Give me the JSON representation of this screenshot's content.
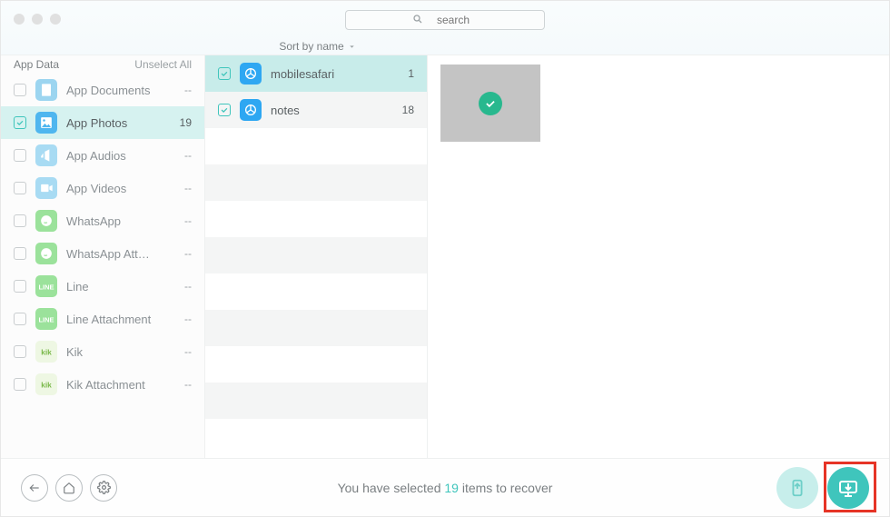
{
  "search": {
    "placeholder": "search"
  },
  "sort": {
    "label": "Sort by name"
  },
  "sidebar": {
    "header_left": "App Data",
    "header_right": "Unselect All",
    "items": [
      {
        "label": "App Documents",
        "count": "--",
        "checked": false,
        "active": false,
        "color": "#9cd5f0",
        "icon": "doc"
      },
      {
        "label": "App Photos",
        "count": "19",
        "checked": true,
        "active": true,
        "color": "#4fb6ef",
        "icon": "photo"
      },
      {
        "label": "App Audios",
        "count": "--",
        "checked": false,
        "active": false,
        "color": "#a8dbf3",
        "icon": "audio"
      },
      {
        "label": "App Videos",
        "count": "--",
        "checked": false,
        "active": false,
        "color": "#a8dbf3",
        "icon": "video"
      },
      {
        "label": "WhatsApp",
        "count": "--",
        "checked": false,
        "active": false,
        "color": "#9be29b",
        "icon": "wa"
      },
      {
        "label": "WhatsApp Att…",
        "count": "--",
        "checked": false,
        "active": false,
        "color": "#9be29b",
        "icon": "wa"
      },
      {
        "label": "Line",
        "count": "--",
        "checked": false,
        "active": false,
        "color": "#9be29b",
        "icon": "line"
      },
      {
        "label": "Line Attachment",
        "count": "--",
        "checked": false,
        "active": false,
        "color": "#9be29b",
        "icon": "line"
      },
      {
        "label": "Kik",
        "count": "--",
        "checked": false,
        "active": false,
        "color": "#d7e9c4",
        "icon": "kik"
      },
      {
        "label": "Kik Attachment",
        "count": "--",
        "checked": false,
        "active": false,
        "color": "#d7e9c4",
        "icon": "kik"
      }
    ]
  },
  "mid": {
    "rows": [
      {
        "label": "mobilesafari",
        "count": "1",
        "checked": true
      },
      {
        "label": "notes",
        "count": "18",
        "checked": true
      }
    ]
  },
  "footer": {
    "prefix": "You have selected ",
    "count": "19",
    "suffix": " items to recover"
  }
}
